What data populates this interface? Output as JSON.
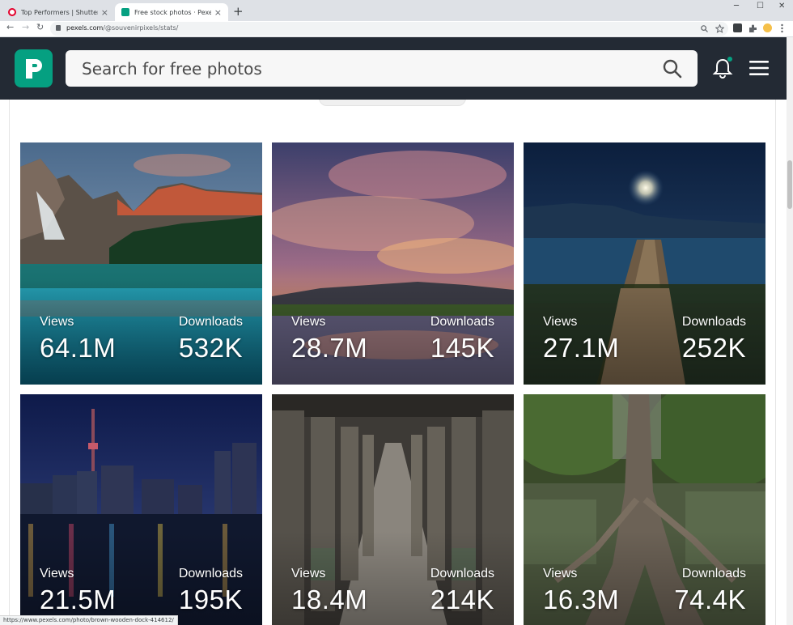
{
  "browser": {
    "tabs": [
      {
        "title": "Top Performers | Shutterstock",
        "close": "×",
        "favicon_color": "#e4002b"
      },
      {
        "title": "Free stock photos · Pexels",
        "close": "×",
        "favicon_color": "#05a081"
      }
    ],
    "new_tab": "+",
    "window_controls": {
      "minimize": "─",
      "maximize": "☐",
      "close": "✕"
    },
    "nav": {
      "back": "←",
      "forward": "→",
      "reload": "↻"
    },
    "url_host": "pexels.com",
    "url_path": "/@souvenirpixels/stats/",
    "status_url": "https://www.pexels.com/photo/brown-wooden-dock-414612/"
  },
  "header": {
    "logo_letter": "P",
    "search_placeholder": "Search for free photos",
    "accent": "#05a081",
    "bg": "#232a34"
  },
  "photos": [
    {
      "views_label": "Views",
      "views": "64.1M",
      "downloads_label": "Downloads",
      "downloads": "532K",
      "scene": "mountain-lake"
    },
    {
      "views_label": "Views",
      "views": "28.7M",
      "downloads_label": "Downloads",
      "downloads": "145K",
      "scene": "sunset-clouds"
    },
    {
      "views_label": "Views",
      "views": "27.1M",
      "downloads_label": "Downloads",
      "downloads": "252K",
      "scene": "moonlit-dock"
    },
    {
      "views_label": "Views",
      "views": "21.5M",
      "downloads_label": "Downloads",
      "downloads": "195K",
      "scene": "city-night"
    },
    {
      "views_label": "Views",
      "views": "18.4M",
      "downloads_label": "Downloads",
      "downloads": "214K",
      "scene": "stone-corridor"
    },
    {
      "views_label": "Views",
      "views": "16.3M",
      "downloads_label": "Downloads",
      "downloads": "74.4K",
      "scene": "temple-tree"
    }
  ]
}
